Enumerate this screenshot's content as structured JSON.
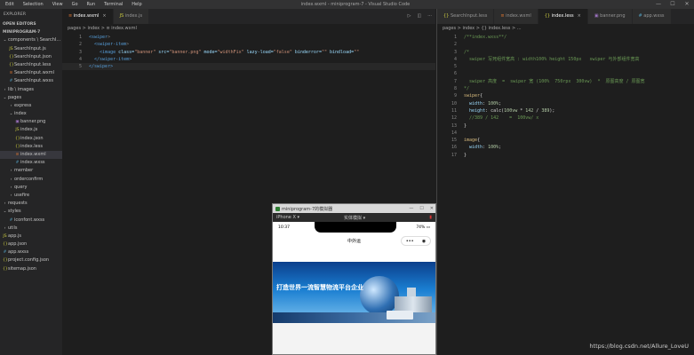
{
  "menu": [
    "Edit",
    "Selection",
    "View",
    "Go",
    "Run",
    "Terminal",
    "Help"
  ],
  "window_title": "index.wxml - miniprogram-7 - Visual Studio Code",
  "window_controls": [
    "—",
    "☐",
    "✕"
  ],
  "sidebar": {
    "header": "EXPLORER",
    "items": [
      {
        "label": "OPEN EDITORS",
        "indent": 0,
        "icon": "",
        "section": true
      },
      {
        "label": "MINIPROGRAM-7",
        "indent": 0,
        "icon": "",
        "section": true
      },
      {
        "label": "components \\ SearchI...",
        "indent": 0,
        "icon": "⌄"
      },
      {
        "label": "SearchInput.js",
        "indent": 1,
        "icon": "JS"
      },
      {
        "label": "SearchInput.json",
        "indent": 1,
        "icon": "{}"
      },
      {
        "label": "SearchInput.less",
        "indent": 1,
        "icon": "{}"
      },
      {
        "label": "SearchInput.wxml",
        "indent": 1,
        "icon": "≡"
      },
      {
        "label": "SearchInput.wxss",
        "indent": 1,
        "icon": "#"
      },
      {
        "label": "lib \\ images",
        "indent": 0,
        "icon": "›"
      },
      {
        "label": "pages",
        "indent": 0,
        "icon": "⌄"
      },
      {
        "label": "express",
        "indent": 1,
        "icon": "›"
      },
      {
        "label": "index",
        "indent": 1,
        "icon": "⌄"
      },
      {
        "label": "banner.png",
        "indent": 2,
        "icon": "▣"
      },
      {
        "label": "index.js",
        "indent": 2,
        "icon": "JS"
      },
      {
        "label": "index.json",
        "indent": 2,
        "icon": "{}"
      },
      {
        "label": "index.less",
        "indent": 2,
        "icon": "{}"
      },
      {
        "label": "index.wxml",
        "indent": 2,
        "icon": "≡",
        "selected": true
      },
      {
        "label": "index.wxss",
        "indent": 2,
        "icon": "#"
      },
      {
        "label": "member",
        "indent": 1,
        "icon": "›"
      },
      {
        "label": "orderconfirm",
        "indent": 1,
        "icon": "›"
      },
      {
        "label": "query",
        "indent": 1,
        "icon": "›"
      },
      {
        "label": "usefire",
        "indent": 1,
        "icon": "›"
      },
      {
        "label": "requests",
        "indent": 0,
        "icon": "›"
      },
      {
        "label": "styles",
        "indent": 0,
        "icon": "⌄"
      },
      {
        "label": "iconfont.wxss",
        "indent": 1,
        "icon": "#"
      },
      {
        "label": "utils",
        "indent": 0,
        "icon": "›"
      },
      {
        "label": "app.js",
        "indent": 0,
        "icon": "JS"
      },
      {
        "label": "app.json",
        "indent": 0,
        "icon": "{}"
      },
      {
        "label": "app.wxss",
        "indent": 0,
        "icon": "#"
      },
      {
        "label": "project.config.json",
        "indent": 0,
        "icon": "{}"
      },
      {
        "label": "sitemap.json",
        "indent": 0,
        "icon": "{}"
      }
    ]
  },
  "left_editor": {
    "tabs": [
      {
        "label": "index.wxml",
        "icon": "≡",
        "active": true
      },
      {
        "label": "index.js",
        "icon": "JS",
        "active": false
      }
    ],
    "actions": [
      "▷",
      "◫",
      "···"
    ],
    "breadcrumb": "pages > index > ≡ index.wxml",
    "lines": [
      {
        "n": "1",
        "tokens": [
          {
            "t": "<swiper",
            "c": "tag"
          },
          {
            "t": ">",
            "c": "punct"
          }
        ]
      },
      {
        "n": "2",
        "tokens": [
          {
            "t": "  <swiper-item",
            "c": "tag"
          },
          {
            "t": ">",
            "c": "punct"
          }
        ]
      },
      {
        "n": "3",
        "tokens": [
          {
            "t": "    <image",
            "c": "tag"
          },
          {
            "t": " class=",
            "c": "attr"
          },
          {
            "t": "\"banner\"",
            "c": "str"
          },
          {
            "t": " src=",
            "c": "attr"
          },
          {
            "t": "\"banner.png\"",
            "c": "str"
          },
          {
            "t": " mode=",
            "c": "attr"
          },
          {
            "t": "\"widthFix\"",
            "c": "str"
          },
          {
            "t": " lazy-load=",
            "c": "attr"
          },
          {
            "t": "\"false\"",
            "c": "str"
          },
          {
            "t": " binderror=",
            "c": "attr"
          },
          {
            "t": "\"\"",
            "c": "str"
          },
          {
            "t": " bindload=",
            "c": "attr"
          },
          {
            "t": "\"\"",
            "c": "str"
          }
        ]
      },
      {
        "n": "4",
        "tokens": [
          {
            "t": "  </swiper-item>",
            "c": "tag"
          }
        ]
      },
      {
        "n": "5",
        "tokens": [
          {
            "t": "</swiper>",
            "c": "tag"
          }
        ],
        "current": true
      }
    ]
  },
  "right_editor": {
    "tabs": [
      {
        "label": "SearchInput.less",
        "icon": "{}",
        "active": false
      },
      {
        "label": "index.wxml",
        "icon": "≡",
        "active": false
      },
      {
        "label": "index.less",
        "icon": "{}",
        "active": true
      },
      {
        "label": "banner.png",
        "icon": "▣",
        "active": false
      },
      {
        "label": "app.wxss",
        "icon": "#",
        "active": false
      }
    ],
    "breadcrumb": "pages > index > {} index.less > ...",
    "lines": [
      {
        "n": "1",
        "tokens": [
          {
            "t": "/**index.wxss**/",
            "c": "cmt"
          }
        ]
      },
      {
        "n": "2",
        "tokens": []
      },
      {
        "n": "3",
        "tokens": [
          {
            "t": "/*",
            "c": "cmt"
          }
        ]
      },
      {
        "n": "4",
        "tokens": [
          {
            "t": "  swiper 写死组件宽高 : width100% height 150px   swiper 与外部组件宽高",
            "c": "cmt"
          }
        ]
      },
      {
        "n": "5",
        "tokens": []
      },
      {
        "n": "6",
        "tokens": []
      },
      {
        "n": "7",
        "tokens": [
          {
            "t": "  swiper 高度  =  swiper 宽 (100%  750rpx  300vw)  *  原图高度 / 原图宽",
            "c": "cmt"
          }
        ]
      },
      {
        "n": "8",
        "tokens": [
          {
            "t": "*/",
            "c": "cmt"
          }
        ]
      },
      {
        "n": "9",
        "tokens": [
          {
            "t": "swiper",
            "c": "sel"
          },
          {
            "t": "{",
            "c": "plain"
          }
        ]
      },
      {
        "n": "10",
        "tokens": [
          {
            "t": "  width",
            "c": "prop"
          },
          {
            "t": ": ",
            "c": "plain"
          },
          {
            "t": "100%",
            "c": "num"
          },
          {
            "t": ";",
            "c": "plain"
          }
        ]
      },
      {
        "n": "11",
        "tokens": [
          {
            "t": "  height",
            "c": "prop"
          },
          {
            "t": ": calc(",
            "c": "plain"
          },
          {
            "t": "100vw",
            "c": "num"
          },
          {
            "t": " * ",
            "c": "plain"
          },
          {
            "t": "142",
            "c": "num"
          },
          {
            "t": " / ",
            "c": "plain"
          },
          {
            "t": "389",
            "c": "num"
          },
          {
            "t": ");",
            "c": "plain"
          }
        ]
      },
      {
        "n": "12",
        "tokens": [
          {
            "t": "  //389 / 142    =  100vw/ x",
            "c": "cmt"
          }
        ]
      },
      {
        "n": "13",
        "tokens": [
          {
            "t": "}",
            "c": "plain"
          }
        ]
      },
      {
        "n": "14",
        "tokens": []
      },
      {
        "n": "15",
        "tokens": [
          {
            "t": "image",
            "c": "sel"
          },
          {
            "t": "{",
            "c": "plain"
          }
        ]
      },
      {
        "n": "16",
        "tokens": [
          {
            "t": "  width",
            "c": "prop"
          },
          {
            "t": ": ",
            "c": "plain"
          },
          {
            "t": "100%",
            "c": "num"
          },
          {
            "t": ";",
            "c": "plain"
          }
        ]
      },
      {
        "n": "17",
        "tokens": [
          {
            "t": "}",
            "c": "plain"
          }
        ]
      }
    ]
  },
  "simulator": {
    "window_title": "miniprogram-7的模拟器",
    "controls": [
      "—",
      "☐",
      "✕"
    ],
    "device": "iPhone X ▾",
    "network": "实体模拟 ▾",
    "status_time": "10:37",
    "battery": "74% ▭",
    "page_title": "中外运",
    "capsule_more": "•••",
    "capsule_close": "◉",
    "banner_text": "打造世界一流智慧物流平台企业"
  },
  "watermark": "https://blog.csdn.net/Allure_LoveU"
}
